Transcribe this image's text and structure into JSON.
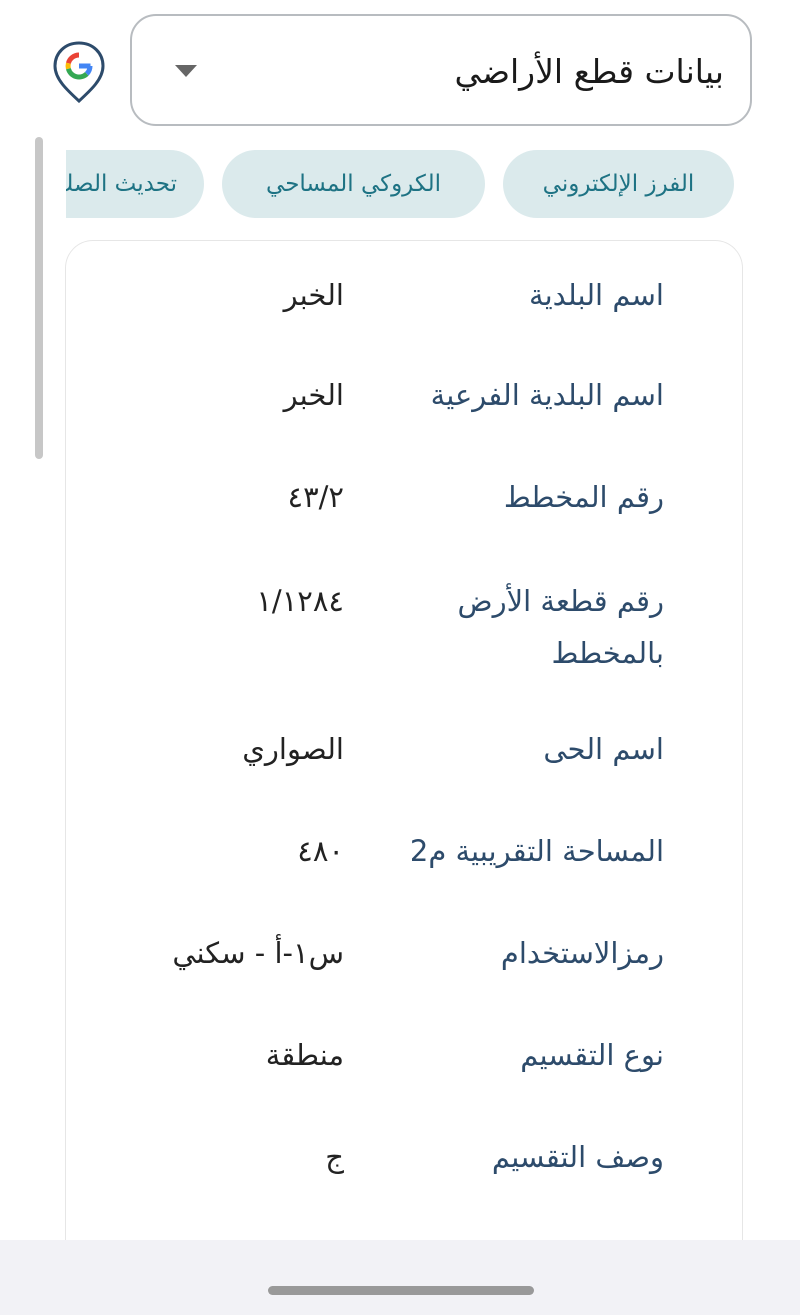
{
  "logo": {
    "letter": "G",
    "icon": "google-pin-icon"
  },
  "dropdown": {
    "selected": "بيانات قطع الأراضي",
    "icon": "caret-down-icon"
  },
  "chips": [
    {
      "label": "الفرز الإلكتروني"
    },
    {
      "label": "الكروكي المساحي"
    },
    {
      "label": "تحديث الصك"
    }
  ],
  "details": [
    {
      "label": "اسم البلدية",
      "value": "الخبر"
    },
    {
      "label": "اسم البلدية الفرعية",
      "value": "الخبر"
    },
    {
      "label": "رقم المخطط",
      "value": "٤٣/٢"
    },
    {
      "label": "رقم قطعة الأرض بالمخطط",
      "value": "١/١٢٨٤"
    },
    {
      "label": "اسم الحى",
      "value": "الصواري"
    },
    {
      "label": "المساحة التقريبية م2",
      "value": "٤٨٠"
    },
    {
      "label": "رمزالاستخدام",
      "value": "س١-أ - سكني"
    },
    {
      "label": "نوع التقسيم",
      "value": "منطقة"
    },
    {
      "label": "وصف التقسيم",
      "value": "ج"
    }
  ],
  "colors": {
    "chip_bg": "#dbeaec",
    "chip_text": "#1e7384",
    "label_text": "#2d4b6b",
    "pin_outline": "#2d4b6b"
  }
}
